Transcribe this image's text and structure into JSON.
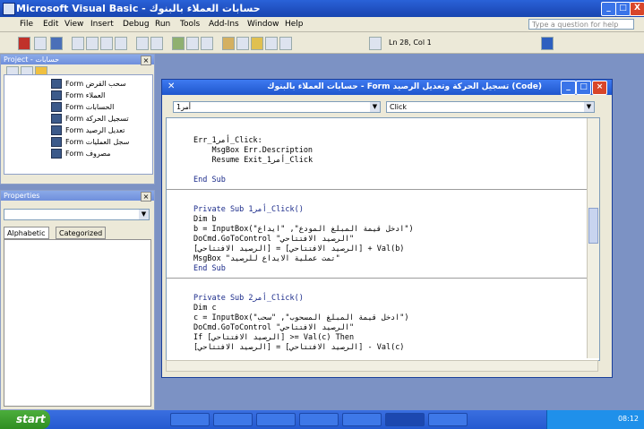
{
  "window": {
    "title": "Microsoft Visual Basic - حسابات العملاء بالبنوك",
    "controls": [
      "_",
      "□",
      "X"
    ]
  },
  "menu": {
    "items": [
      "File",
      "Edit",
      "View",
      "Insert",
      "Debug",
      "Run",
      "Tools",
      "Add-Ins",
      "Window",
      "Help"
    ],
    "ask_placeholder": "Type a question for help"
  },
  "toolbar": {
    "cursor_position": "Ln 28, Col 1"
  },
  "project_pane": {
    "title": "Project - حسابات",
    "items": [
      "Form سحب القرض",
      "Form العملاء",
      "Form الحسابات",
      "Form تسجيل الحركة",
      "Form تعديل الرصيد",
      "Form سجل العمليات",
      "Form مصروف"
    ]
  },
  "properties_pane": {
    "title": "Properties",
    "tabs": [
      "Alphabetic",
      "Categorized"
    ]
  },
  "code_window": {
    "title": "حسابات العملاء بالبنوك - Form تسجيل الحركة وتعديل الرصيد (Code)",
    "object_combo": "أمر1",
    "proc_combo": "Click",
    "lines": [
      "Err_أمر1_Click:",
      "    MsgBox Err.Description",
      "    Resume Exit_أمر1_Click",
      "",
      "End Sub",
      "",
      "Private Sub أمر1_Click()",
      "Dim b",
      "b = InputBox(\"ادخل قيمة المبلغ المودع\", \"ايداع\")",
      "DoCmd.GoToControl \"الرصيد الافتتاحي\"",
      "[الرصيد الافتتاحي] = [الرصيد الافتتاحي] + Val(b)",
      "MsgBox \"تمت عملية الايداع للرصيد\"",
      "End Sub",
      "",
      "Private Sub أمر2_Click()",
      "Dim c",
      "c = InputBox(\"ادخل قيمة المبلغ المسحوب\", \"سحب\")",
      "DoCmd.GoToControl \"الرصيد الافتتاحي\"",
      "If [الرصيد الافتتاحي] >= Val(c) Then",
      "[الرصيد الافتتاحي] = [الرصيد الافتتاحي] - Val(c)"
    ]
  },
  "taskbar": {
    "start_label": "start",
    "tasks": [
      "",
      "",
      "",
      "",
      "",
      "",
      ""
    ],
    "clock": "08:12"
  },
  "colors": {
    "titlebar": "#1f4fbf",
    "keyword": "#1a2a8a",
    "start_button": "#3a9b2d"
  }
}
